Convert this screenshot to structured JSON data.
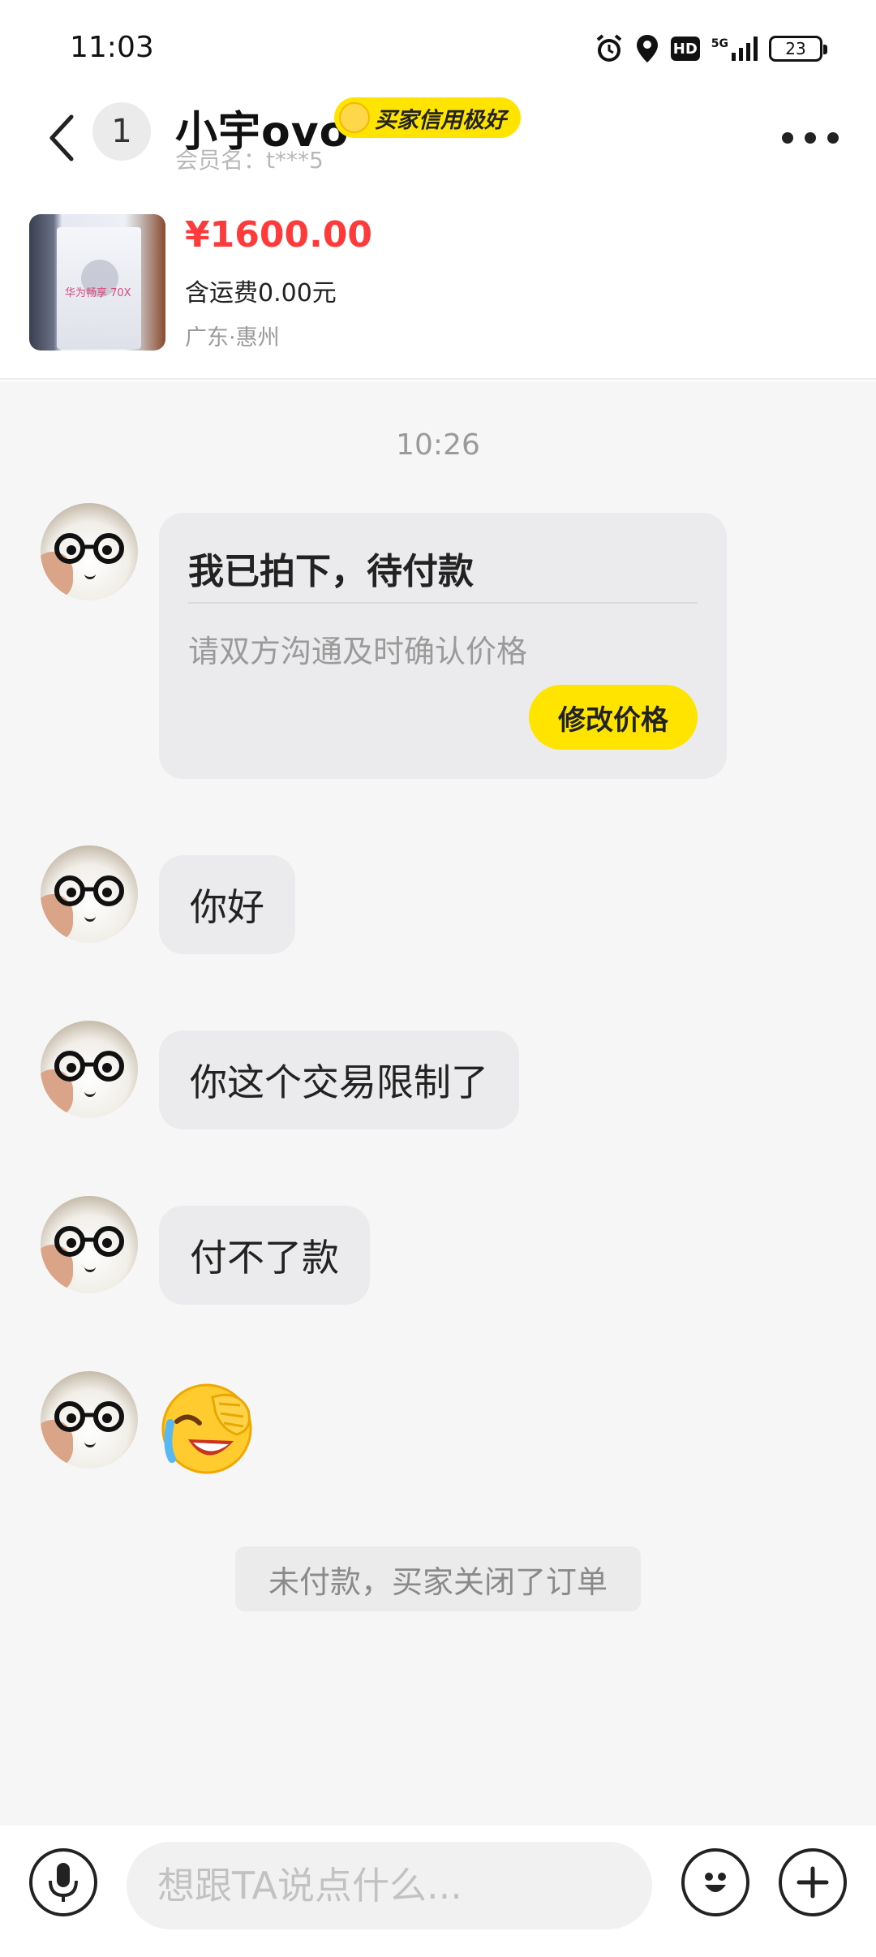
{
  "status_bar": {
    "time": "11:03",
    "network": "5G",
    "battery_level": "23",
    "icons": [
      "alarm-icon",
      "location-icon",
      "hd-icon",
      "signal-icon",
      "battery-icon"
    ]
  },
  "header": {
    "unread_count": "1",
    "nickname": "小宇ovo",
    "credit_badge": "买家信用极好",
    "member_label": "会员名：t***5"
  },
  "product": {
    "price": "¥1600.00",
    "shipping": "含运费0.00元",
    "location": "广东·惠州",
    "thumb_text": "华为畅享 70X"
  },
  "chat": {
    "time_divider": "10:26",
    "order_card": {
      "title": "我已拍下，待付款",
      "subtitle": "请双方沟通及时确认价格",
      "button": "修改价格"
    },
    "messages": [
      {
        "text": "你好"
      },
      {
        "text": "你这个交易限制了"
      },
      {
        "text": "付不了款"
      }
    ],
    "emoji_message": "crying-laughing-emoji",
    "system_notice": "未付款，买家关闭了订单"
  },
  "input_bar": {
    "placeholder": "想跟TA说点什么..."
  },
  "colors": {
    "brand_yellow": "#ffe400",
    "price_red": "#ff3a3a",
    "bubble_gray": "#ebebed",
    "chat_bg": "#f6f6f6"
  }
}
